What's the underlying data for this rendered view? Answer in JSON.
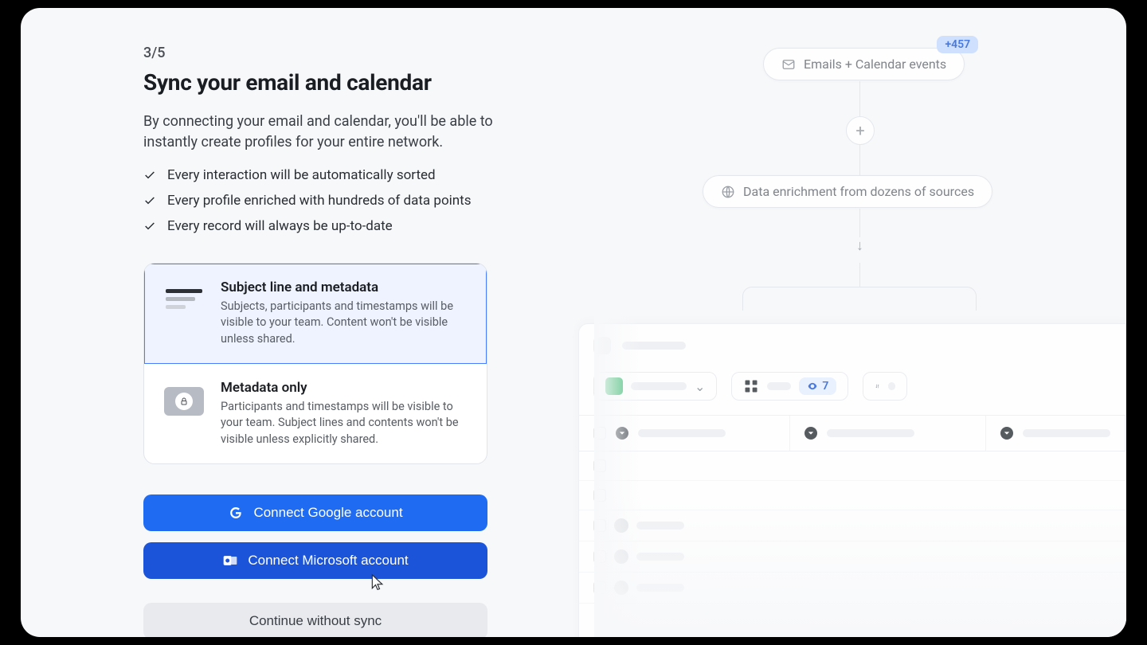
{
  "step": {
    "label": "3/5"
  },
  "title": "Sync your email and calendar",
  "subtitle": "By connecting your email and calendar, you'll be able to instantly create profiles for your entire network.",
  "checks": [
    "Every interaction will be automatically sorted",
    "Every profile enriched with hundreds of data points",
    "Every record will always be up-to-date"
  ],
  "options": [
    {
      "title": "Subject line and metadata",
      "desc": "Subjects, participants and timestamps will be visible to your team. Content won't be visible unless shared.",
      "selected": true
    },
    {
      "title": "Metadata only",
      "desc": "Participants and timestamps will be visible to your team. Subject lines and contents won't be visible unless explicitly shared.",
      "selected": false
    }
  ],
  "actions": {
    "google": "Connect Google account",
    "microsoft": "Connect Microsoft account",
    "skip": "Continue without sync"
  },
  "preview": {
    "emails_node": "Emails + Calendar events",
    "emails_badge": "+457",
    "enrich_node": "Data enrichment from dozens of sources",
    "filter_chip_count": "7"
  }
}
